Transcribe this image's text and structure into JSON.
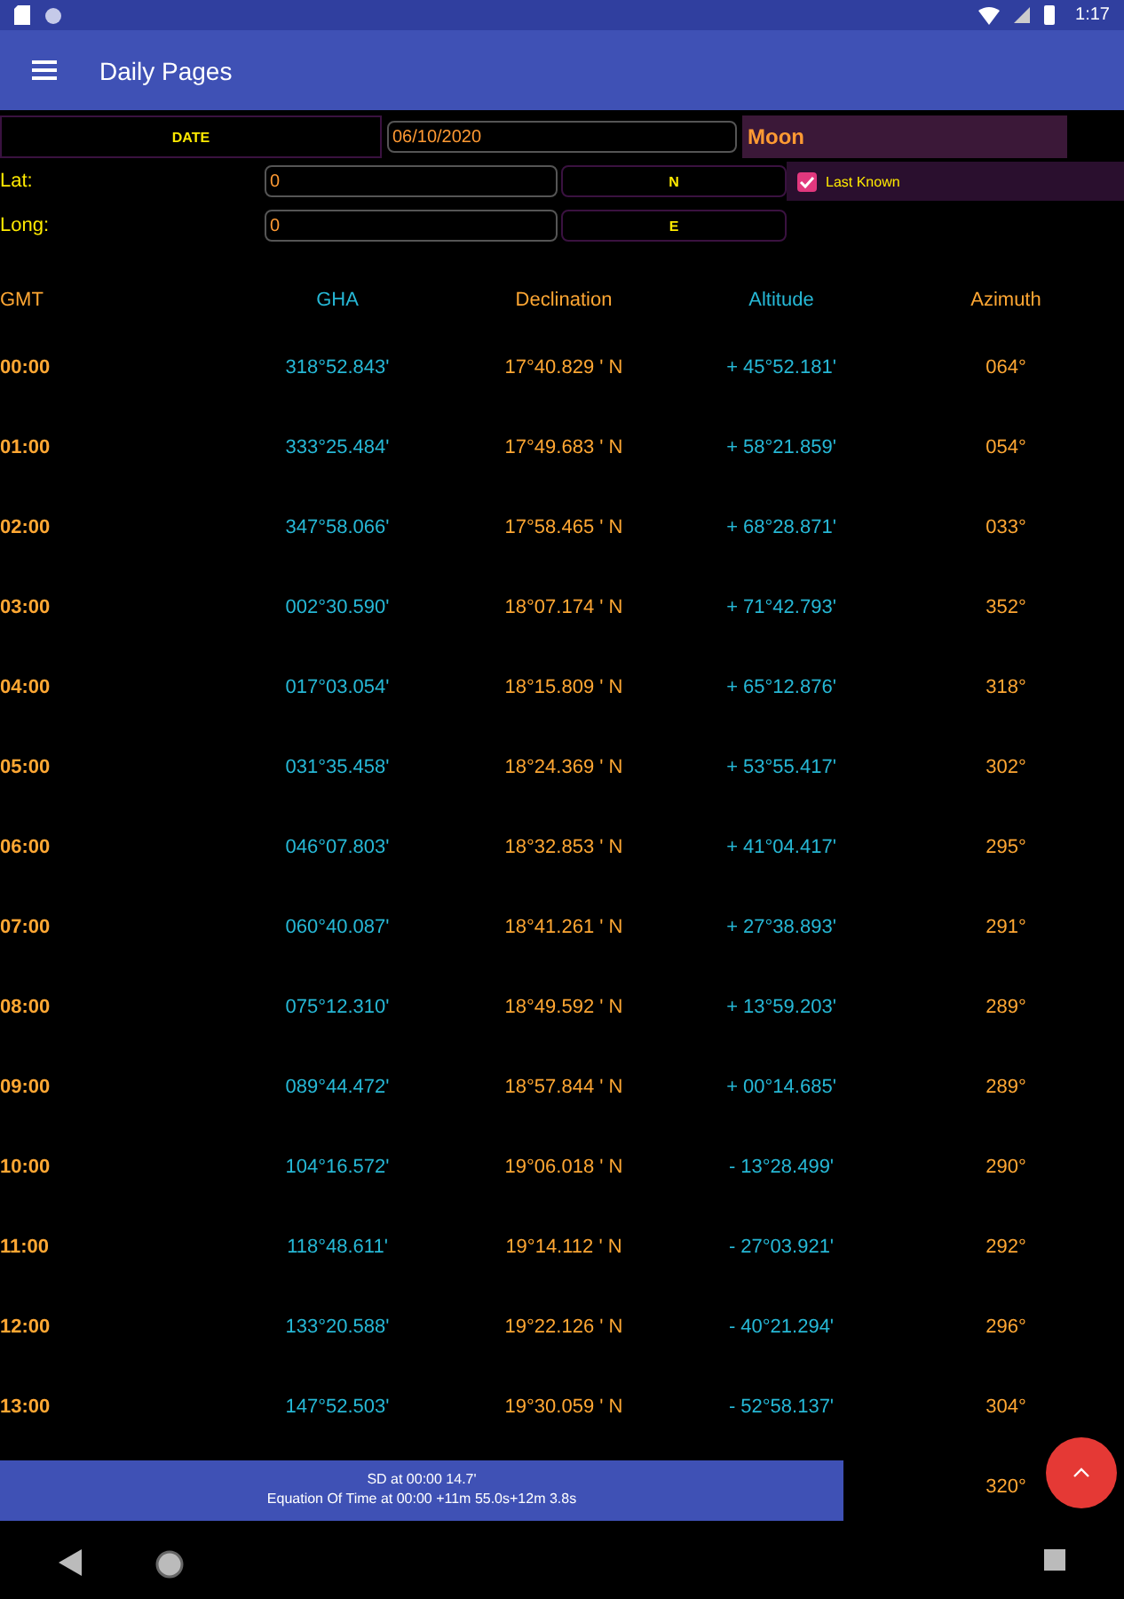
{
  "status_bar": {
    "time": "1:17"
  },
  "app_bar": {
    "title": "Daily Pages"
  },
  "form": {
    "date_label": "DATE",
    "date_value": "06/10/2020",
    "body": "Moon",
    "lat_label": "Lat:",
    "lat_value": "0",
    "lat_hemisphere": "N",
    "last_known": {
      "label": "Last Known",
      "checked": true
    },
    "long_label": "Long:",
    "long_value": "0",
    "long_hemisphere": "E"
  },
  "table": {
    "columns": [
      "GMT",
      "GHA",
      "Declination",
      "Altitude",
      "Azimuth"
    ],
    "rows": [
      [
        "00:00",
        "318°52.843'",
        "17°40.829 ' N",
        "+ 45°52.181'",
        "064°"
      ],
      [
        "01:00",
        "333°25.484'",
        "17°49.683 ' N",
        "+ 58°21.859'",
        "054°"
      ],
      [
        "02:00",
        "347°58.066'",
        "17°58.465 ' N",
        "+ 68°28.871'",
        "033°"
      ],
      [
        "03:00",
        "002°30.590'",
        "18°07.174 ' N",
        "+ 71°42.793'",
        "352°"
      ],
      [
        "04:00",
        "017°03.054'",
        "18°15.809 ' N",
        "+ 65°12.876'",
        "318°"
      ],
      [
        "05:00",
        "031°35.458'",
        "18°24.369 ' N",
        "+ 53°55.417'",
        "302°"
      ],
      [
        "06:00",
        "046°07.803'",
        "18°32.853 ' N",
        "+ 41°04.417'",
        "295°"
      ],
      [
        "07:00",
        "060°40.087'",
        "18°41.261 ' N",
        "+ 27°38.893'",
        "291°"
      ],
      [
        "08:00",
        "075°12.310'",
        "18°49.592 ' N",
        "+ 13°59.203'",
        "289°"
      ],
      [
        "09:00",
        "089°44.472'",
        "18°57.844 ' N",
        "+ 00°14.685'",
        "289°"
      ],
      [
        "10:00",
        "104°16.572'",
        "19°06.018 ' N",
        "- 13°28.499'",
        "290°"
      ],
      [
        "11:00",
        "118°48.611'",
        "19°14.112 ' N",
        "- 27°03.921'",
        "292°"
      ],
      [
        "12:00",
        "133°20.588'",
        "19°22.126 ' N",
        "- 40°21.294'",
        "296°"
      ],
      [
        "13:00",
        "147°52.503'",
        "19°30.059 ' N",
        "- 52°58.137'",
        "304°"
      ],
      [
        "",
        "",
        "",
        "",
        "320°"
      ]
    ]
  },
  "banner": {
    "lines": [
      "SD at 00:00 14.7'",
      "Equation Of Time at 00:00 +11m 55.0s+12m 3.8s"
    ]
  }
}
